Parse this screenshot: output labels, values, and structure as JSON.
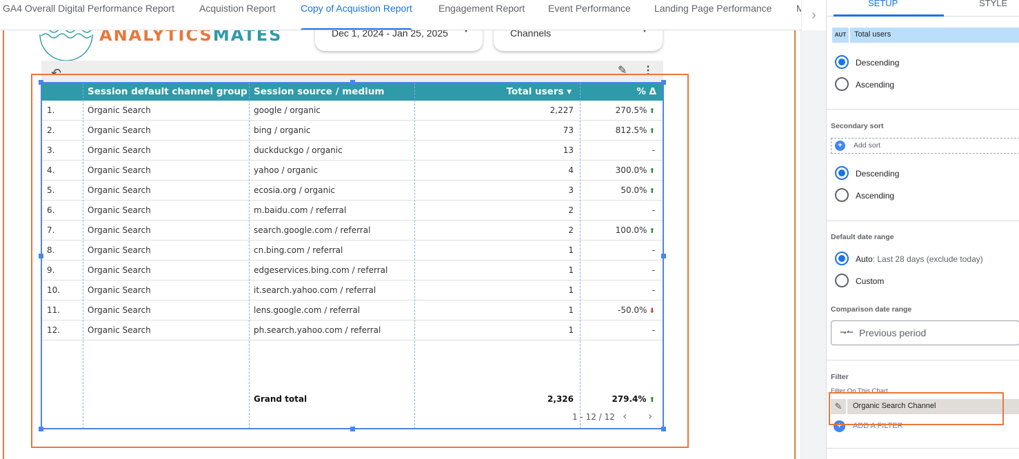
{
  "tabs": [
    {
      "label": "GA4 Overall Digital Performance Report",
      "active": false
    },
    {
      "label": "Acquistion Report",
      "active": false
    },
    {
      "label": "Copy of Acquistion Report",
      "active": true
    },
    {
      "label": "Engagement Report",
      "active": false
    },
    {
      "label": "Event Performance",
      "active": false
    },
    {
      "label": "Landing Page Performance",
      "active": false
    },
    {
      "label": "M",
      "active": false
    }
  ],
  "logo": {
    "part1": "ANALYTICS",
    "part2": "MATES"
  },
  "controls": {
    "date_range": "Dec 1, 2024 - Jan 25, 2025",
    "channels": "Channels"
  },
  "table": {
    "headers": {
      "index": "",
      "channel_group": "Session default channel group",
      "source_medium": "Session source / medium",
      "total_users": "Total users ▾",
      "pct_change": "% Δ"
    },
    "rows": [
      {
        "idx": "1.",
        "channel": "Organic Search",
        "source": "google / organic",
        "users": "2,227",
        "pct": "270.5%",
        "trend": "up"
      },
      {
        "idx": "2.",
        "channel": "Organic Search",
        "source": "bing / organic",
        "users": "73",
        "pct": "812.5%",
        "trend": "up"
      },
      {
        "idx": "3.",
        "channel": "Organic Search",
        "source": "duckduckgo / organic",
        "users": "13",
        "pct": "-",
        "trend": "none"
      },
      {
        "idx": "4.",
        "channel": "Organic Search",
        "source": "yahoo / organic",
        "users": "4",
        "pct": "300.0%",
        "trend": "up"
      },
      {
        "idx": "5.",
        "channel": "Organic Search",
        "source": "ecosia.org / organic",
        "users": "3",
        "pct": "50.0%",
        "trend": "up"
      },
      {
        "idx": "6.",
        "channel": "Organic Search",
        "source": "m.baidu.com / referral",
        "users": "2",
        "pct": "-",
        "trend": "none"
      },
      {
        "idx": "7.",
        "channel": "Organic Search",
        "source": "search.google.com / referral",
        "users": "2",
        "pct": "100.0%",
        "trend": "up"
      },
      {
        "idx": "8.",
        "channel": "Organic Search",
        "source": "cn.bing.com / referral",
        "users": "1",
        "pct": "-",
        "trend": "none"
      },
      {
        "idx": "9.",
        "channel": "Organic Search",
        "source": "edgeservices.bing.com / referral",
        "users": "1",
        "pct": "-",
        "trend": "none"
      },
      {
        "idx": "10.",
        "channel": "Organic Search",
        "source": "it.search.yahoo.com / referral",
        "users": "1",
        "pct": "-",
        "trend": "none"
      },
      {
        "idx": "11.",
        "channel": "Organic Search",
        "source": "lens.google.com / referral",
        "users": "1",
        "pct": "-50.0%",
        "trend": "down"
      },
      {
        "idx": "12.",
        "channel": "Organic Search",
        "source": "ph.search.yahoo.com / referral",
        "users": "1",
        "pct": "-",
        "trend": "none"
      }
    ],
    "grand_total": {
      "label": "Grand total",
      "users": "2,326",
      "pct": "279.4%",
      "trend": "up"
    },
    "pagination": "1 - 12 / 12"
  },
  "panel": {
    "tabs": {
      "setup": "SETUP",
      "style": "STYLE"
    },
    "sort_field": {
      "badge": "AUT",
      "name": "Total users"
    },
    "sort_order": {
      "descending": "Descending",
      "ascending": "Ascending",
      "selected": "descending"
    },
    "secondary_sort": {
      "title": "Secondary sort",
      "add_label": "Add sort",
      "descending": "Descending",
      "ascending": "Ascending",
      "selected": "descending"
    },
    "default_date_range": {
      "title": "Default date range",
      "auto_label": "Auto",
      "auto_detail": ": Last 28 days (exclude today)",
      "custom_label": "Custom",
      "selected": "auto"
    },
    "comparison": {
      "title": "Comparison date range",
      "value": "Previous period"
    },
    "filter": {
      "title": "Filter",
      "subtitle": "Filter On This Chart",
      "chip": "Organic Search Channel",
      "add_label": "ADD A FILTER"
    }
  },
  "colors": {
    "accent": "#1a73e8",
    "table_header": "#2e9aaa",
    "selection_orange": "#e8773a",
    "positive": "#2e8b3e",
    "negative": "#d93025"
  }
}
